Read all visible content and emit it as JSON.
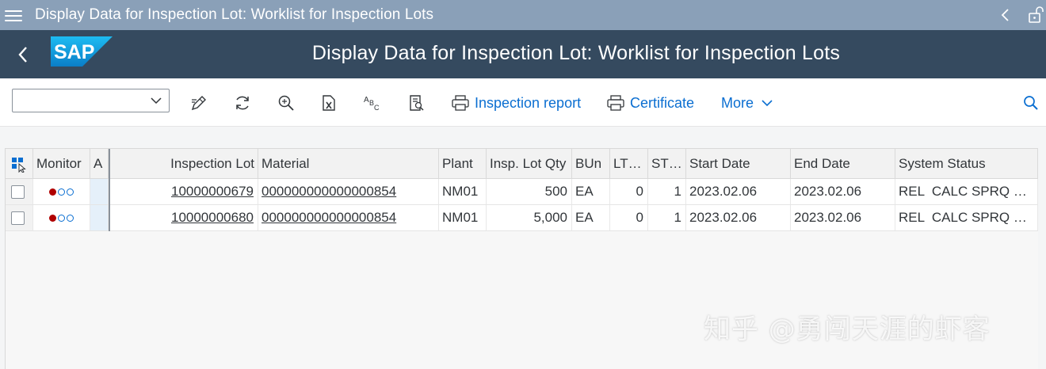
{
  "window": {
    "title": "Display Data for Inspection Lot: Worklist for Inspection Lots"
  },
  "shell": {
    "title": "Display Data for Inspection Lot: Worklist for Inspection Lots",
    "logo_text": "SAP"
  },
  "toolbar": {
    "variant_value": "",
    "buttons": [
      {
        "icon": "edit-icon"
      },
      {
        "icon": "refresh-icon"
      },
      {
        "icon": "zoom-icon"
      },
      {
        "icon": "excel-export-icon"
      },
      {
        "icon": "spell-check-icon"
      },
      {
        "icon": "document-search-icon"
      }
    ],
    "inspection_report": "Inspection report",
    "certificate": "Certificate",
    "more": "More"
  },
  "table": {
    "columns": [
      "Monitor",
      "A",
      "Inspection Lot",
      "Material",
      "Plant",
      "Insp. Lot Qty",
      "BUn",
      "LT…",
      "ST…",
      "Start Date",
      "End Date",
      "System Status"
    ],
    "rows": [
      {
        "inspection_lot": "10000000679",
        "material": "000000000000000854",
        "plant": "NM01",
        "qty": "500",
        "bun": "EA",
        "lt": "0",
        "st": "1",
        "start": "2023.02.06",
        "end": "2023.02.06",
        "status": "REL  CALC SPRQ …"
      },
      {
        "inspection_lot": "10000000680",
        "material": "000000000000000854",
        "plant": "NM01",
        "qty": "5,000",
        "bun": "EA",
        "lt": "0",
        "st": "1",
        "start": "2023.02.06",
        "end": "2023.02.06",
        "status": "REL  CALC SPRQ …"
      }
    ]
  },
  "watermark": "知乎 @勇闯天涯的虾客",
  "colors": {
    "shell": "#354a5f",
    "winbar": "#8aa0b8",
    "accent": "#0a6ed1",
    "status_red": "#b00000"
  }
}
